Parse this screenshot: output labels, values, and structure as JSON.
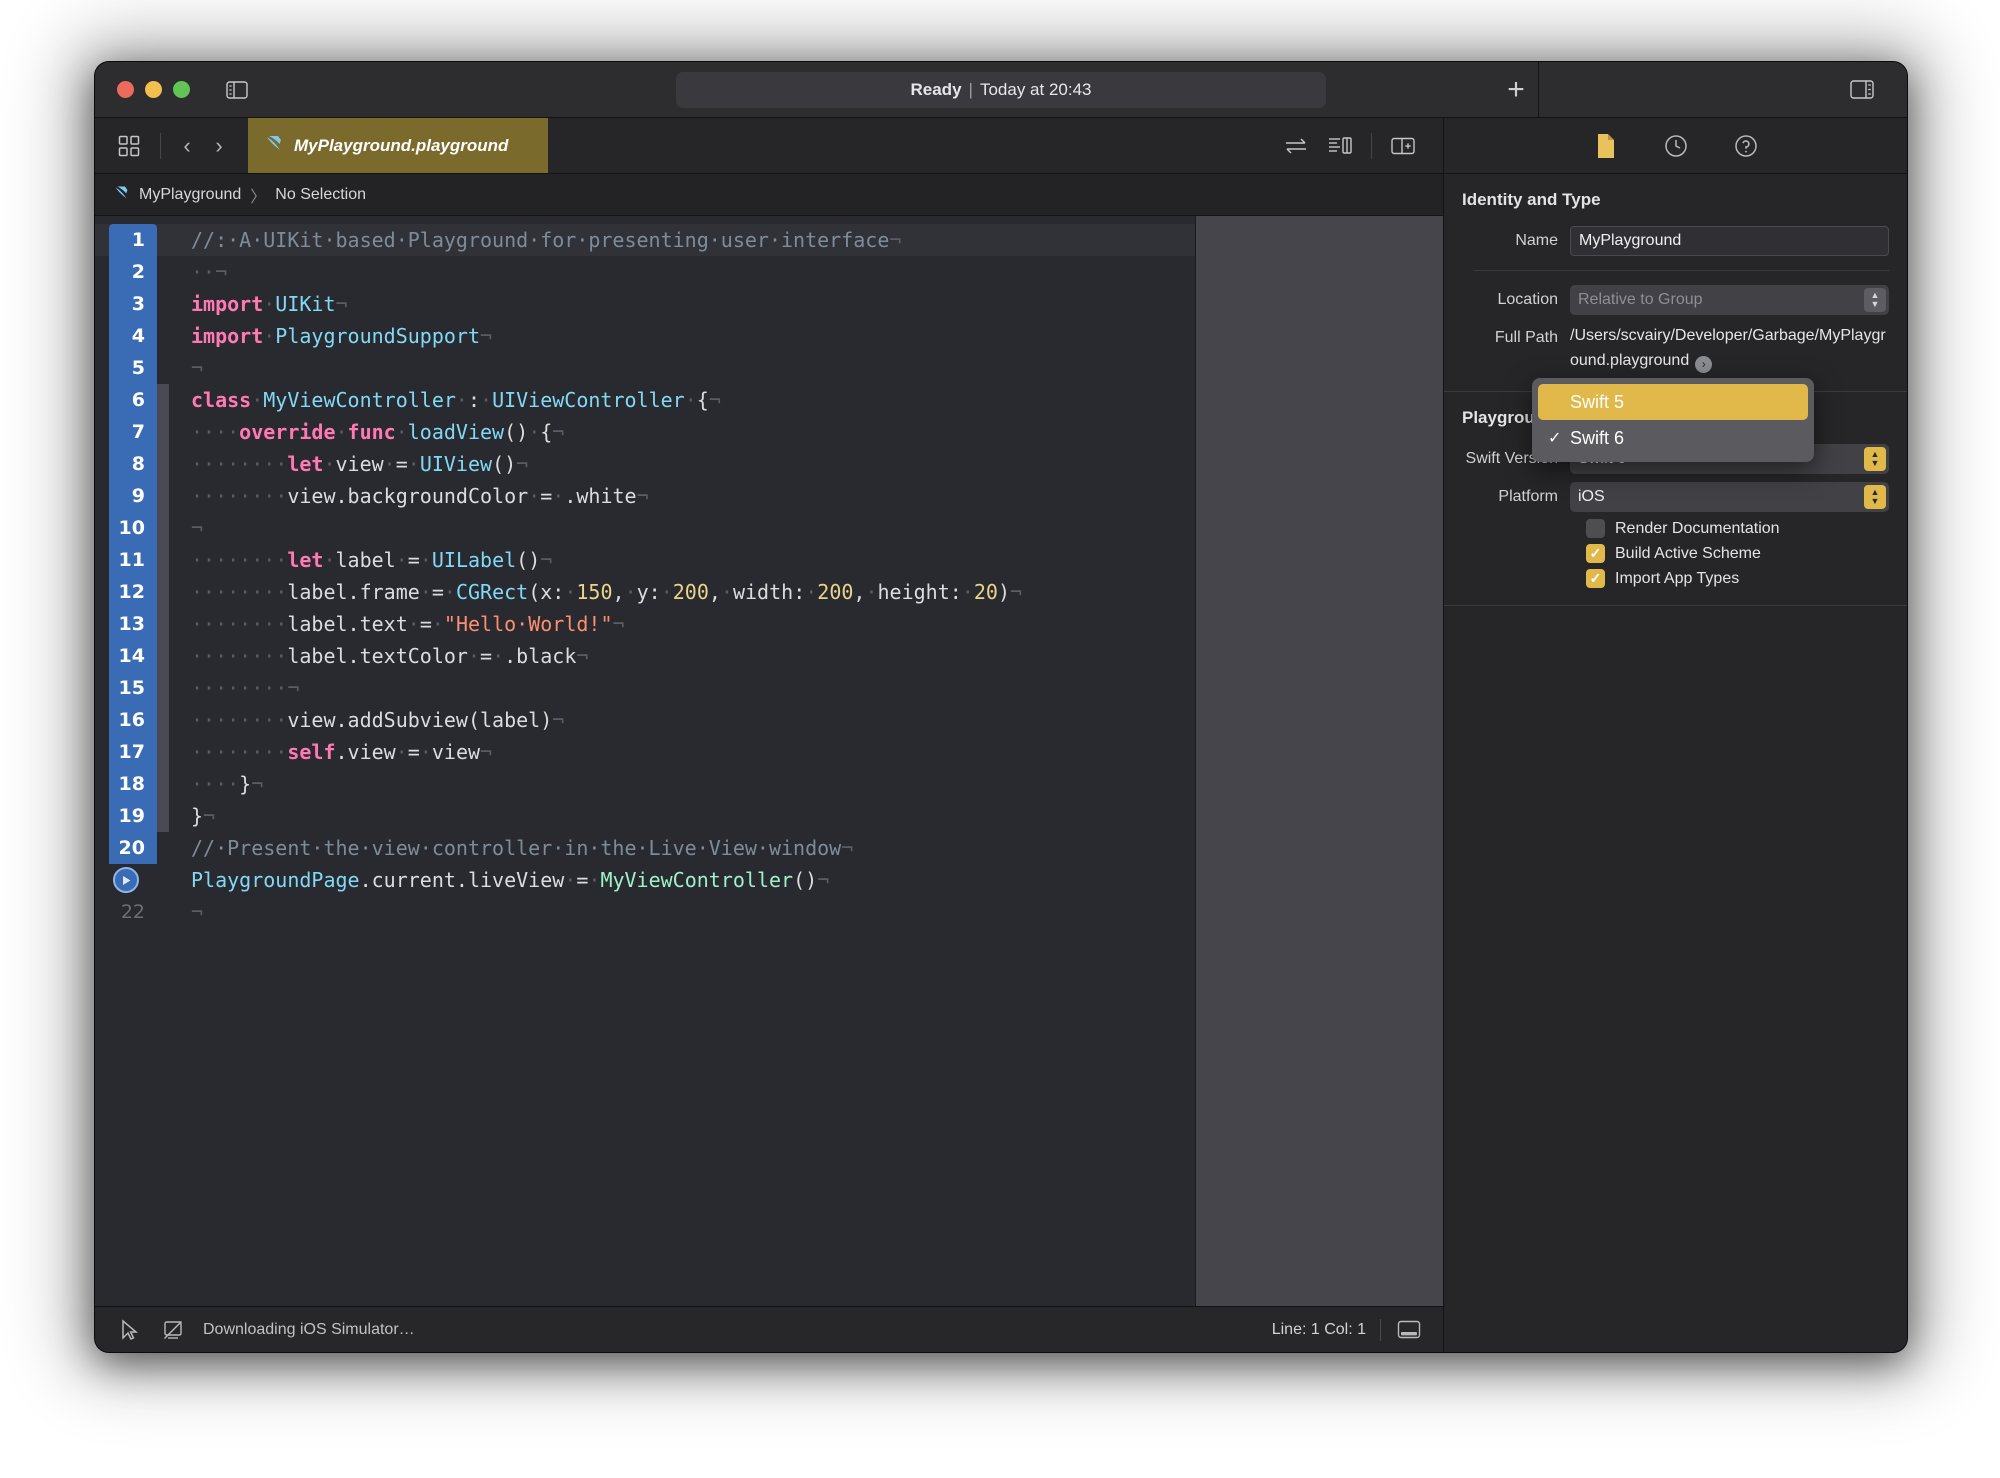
{
  "window": {
    "status_bold": "Ready",
    "status_sep": "|",
    "status_rest": "Today at 20:43",
    "plus_label": "+"
  },
  "tabbar": {
    "nav_back": "‹",
    "nav_forward": "›",
    "active_tab": "MyPlayground.playground"
  },
  "breadcrumb": {
    "project": "MyPlayground",
    "separator": "〉",
    "selection": "No Selection"
  },
  "editor": {
    "lines": [
      {
        "n": "1",
        "sel": true,
        "fold": false,
        "run": false
      },
      {
        "n": "2",
        "sel": true,
        "fold": false,
        "run": false
      },
      {
        "n": "3",
        "sel": true,
        "fold": false,
        "run": false
      },
      {
        "n": "4",
        "sel": true,
        "fold": false,
        "run": false
      },
      {
        "n": "5",
        "sel": true,
        "fold": false,
        "run": false
      },
      {
        "n": "6",
        "sel": true,
        "fold": true,
        "run": false
      },
      {
        "n": "7",
        "sel": true,
        "fold": true,
        "run": false
      },
      {
        "n": "8",
        "sel": true,
        "fold": true,
        "run": false
      },
      {
        "n": "9",
        "sel": true,
        "fold": true,
        "run": false
      },
      {
        "n": "10",
        "sel": true,
        "fold": true,
        "run": false
      },
      {
        "n": "11",
        "sel": true,
        "fold": true,
        "run": false
      },
      {
        "n": "12",
        "sel": true,
        "fold": true,
        "run": false
      },
      {
        "n": "13",
        "sel": true,
        "fold": true,
        "run": false
      },
      {
        "n": "14",
        "sel": true,
        "fold": true,
        "run": false
      },
      {
        "n": "15",
        "sel": true,
        "fold": true,
        "run": false
      },
      {
        "n": "16",
        "sel": true,
        "fold": true,
        "run": false
      },
      {
        "n": "17",
        "sel": true,
        "fold": true,
        "run": false
      },
      {
        "n": "18",
        "sel": true,
        "fold": true,
        "run": false
      },
      {
        "n": "19",
        "sel": true,
        "fold": true,
        "run": false
      },
      {
        "n": "20",
        "sel": true,
        "fold": false,
        "run": false
      },
      {
        "n": "21",
        "sel": true,
        "fold": false,
        "run": true
      },
      {
        "n": "22",
        "sel": false,
        "fold": false,
        "run": false
      }
    ],
    "code_text": [
      "//: A UIKit based Playground for presenting user interface",
      "  ",
      "import UIKit",
      "import PlaygroundSupport",
      "",
      "class MyViewController : UIViewController {",
      "    override func loadView() {",
      "        let view = UIView()",
      "        view.backgroundColor = .white",
      "",
      "        let label = UILabel()",
      "        label.frame = CGRect(x: 150, y: 200, width: 200, height: 20)",
      "        label.text = \"Hello World!\"",
      "        label.textColor = .black",
      "        ",
      "        view.addSubview(label)",
      "        self.view = view",
      "    }",
      "}",
      "// Present the view controller in the Live View window",
      "PlaygroundPage.current.liveView = MyViewController()",
      ""
    ]
  },
  "statusbar": {
    "message": "Downloading iOS Simulator…",
    "line_col": "Line: 1  Col: 1"
  },
  "inspector": {
    "section_title": "Identity and Type",
    "name_label": "Name",
    "name_value": "MyPlayground",
    "location_label": "Location",
    "location_value": "Relative to Group",
    "fullpath_label": "Full Path",
    "fullpath_value": "/Users/scvairy/Developer/Garbage/MyPlayground.playground",
    "playground_section": "Playground Settings",
    "swift_version_label": "Swift Version",
    "swift_version_value": "Swift 6",
    "platform_label": "Platform",
    "platform_value": "iOS",
    "checkboxes": [
      {
        "label": "Render Documentation",
        "checked": false
      },
      {
        "label": "Build Active Scheme",
        "checked": true
      },
      {
        "label": "Import App Types",
        "checked": true
      }
    ]
  },
  "swift_menu": {
    "items": [
      {
        "label": "Swift 5",
        "selected": true,
        "checked": false
      },
      {
        "label": "Swift 6",
        "selected": false,
        "checked": true
      }
    ],
    "check_glyph": "✓"
  }
}
